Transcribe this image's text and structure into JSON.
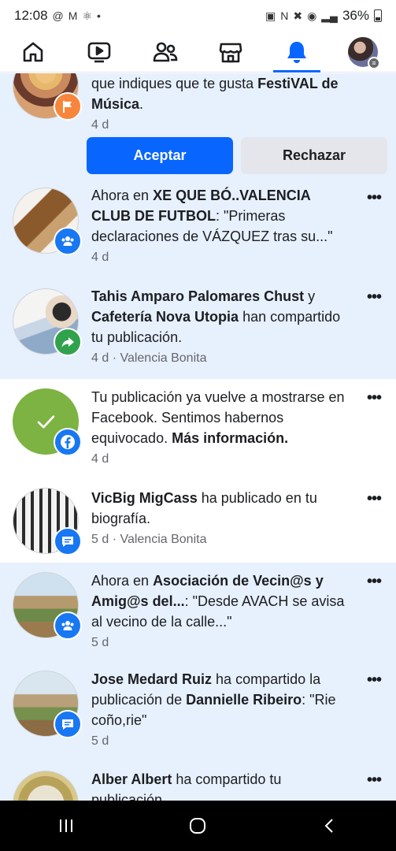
{
  "status_bar": {
    "time": "12:08",
    "battery": "36%"
  },
  "nav": {
    "items": [
      "home-icon",
      "video-icon",
      "friends-icon",
      "marketplace-icon",
      "notifications-icon",
      "profile-avatar"
    ],
    "active": "notifications-icon",
    "accent": "#0866ff"
  },
  "notifications": [
    {
      "text_pre": "que indiques que te gusta ",
      "bold": "FestiVAL de Música",
      "text_post": ".",
      "time": "4 d",
      "badge": "flag-icon",
      "unread": true,
      "accept_label": "Aceptar",
      "reject_label": "Rechazar"
    },
    {
      "text_pre": "Ahora en ",
      "bold": "XE QUE BÓ..VALENCIA CLUB DE FUTBOL",
      "text_post": ": \"Primeras declaraciones de VÁZQUEZ tras su...\"",
      "time": "4 d",
      "badge": "group-icon",
      "unread": true
    },
    {
      "bold1": "Tahis Amparo Palomares Chust",
      "mid": " y ",
      "bold2": "Cafetería Nova Utopia",
      "post": " han compartido tu publicación.",
      "time": "4 d · Valencia Bonita",
      "badge": "share-icon",
      "unread": true
    },
    {
      "text_pre": "Tu publicación ya vuelve a mostrarse en Facebook. Sentimos habernos equivocado. ",
      "bold": "Más información.",
      "time": "4 d",
      "badge": "facebook-icon",
      "unread": false
    },
    {
      "bold": "VicBig MigCass",
      "text_post": " ha publicado en tu biografía.",
      "time": "5 d · Valencia Bonita",
      "badge": "comment-icon",
      "unread": false
    },
    {
      "text_pre": "Ahora en ",
      "bold": "Asociación de Vecin@s y Amig@s del...",
      "text_post": ": \"Desde AVACH se avisa al vecino de la calle...\"",
      "time": "5 d",
      "badge": "group-icon",
      "unread": true
    },
    {
      "bold1": "Jose Medard Ruiz",
      "mid": " ha compartido la publicación de ",
      "bold2": "Dannielle Ribeiro",
      "post": ": \"Rie coño,rie\"",
      "time": "5 d",
      "badge": "comment-icon",
      "unread": true
    },
    {
      "bold": "Alber Albert",
      "text_post": " ha compartido tu publicación.",
      "unread": true
    }
  ]
}
